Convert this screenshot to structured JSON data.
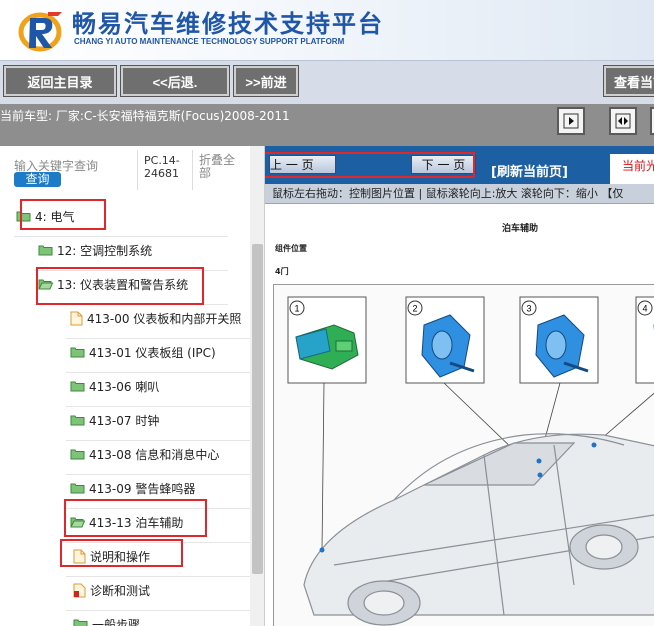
{
  "header": {
    "title": "畅易汽车维修技术支持平台",
    "subtitle": "CHANG YI AUTO MAINTENANCE TECHNOLOGY SUPPORT PLATFORM"
  },
  "toolbar": {
    "home_label": "返回主目录",
    "back_label": "<<后退.",
    "forward_label": ">>前进",
    "view_label": "查看当前"
  },
  "vehicle": {
    "text": "当前车型:  厂家:C-长安福特福克斯(Focus)2008-2011"
  },
  "sidebar": {
    "search_placeholder": "输入关键字查询",
    "search_button": "查询",
    "code": "PC.14-24681",
    "collapse_all": "折叠全部",
    "tree": [
      {
        "label": "4: 电气",
        "icon": "folder-icon"
      },
      {
        "label": "12: 空调控制系统",
        "icon": "folder-icon"
      },
      {
        "label": "13: 仪表装置和警告系统",
        "icon": "folder-open-icon"
      },
      {
        "label": "413-00 仪表板和内部开关照",
        "icon": "document-icon"
      },
      {
        "label": "413-01 仪表板组 (IPC)",
        "icon": "folder-icon"
      },
      {
        "label": "413-06 喇叭",
        "icon": "folder-icon"
      },
      {
        "label": "413-07 时钟",
        "icon": "folder-icon"
      },
      {
        "label": "413-08 信息和消息中心",
        "icon": "folder-icon"
      },
      {
        "label": "413-09 警告蜂鸣器",
        "icon": "folder-icon"
      },
      {
        "label": "413-13 泊车辅助",
        "icon": "folder-open-icon"
      },
      {
        "label": "说明和操作",
        "icon": "document-icon"
      },
      {
        "label": "诊断和测试",
        "icon": "document-red-icon"
      },
      {
        "label": "一般步骤",
        "icon": "folder-icon"
      }
    ]
  },
  "viewer": {
    "prev_label": "上 一 页",
    "next_label": "下 一 页",
    "refresh_label": "[刷新当前页]",
    "current_label": "当前光",
    "hint": "鼠标左右拖动：控制图片位置 | 鼠标滚轮向上:放大  滚轮向下：缩小 【仅"
  },
  "document": {
    "title": "泊车辅助",
    "heading": "组件位置",
    "subheading": "4门",
    "callouts": [
      "1",
      "2",
      "3",
      "4"
    ]
  },
  "colors": {
    "brand_blue": "#1f56a8",
    "nav_blue": "#1d5fa3",
    "highlight_red": "#e0272c"
  }
}
